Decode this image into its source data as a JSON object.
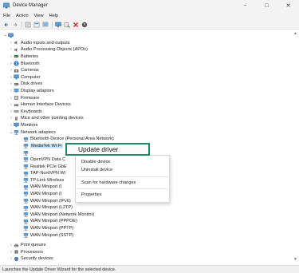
{
  "window": {
    "title": "Device Manager",
    "controls": {
      "minimize": "−",
      "maximize": "□",
      "close": "✕"
    }
  },
  "menubar": [
    "File",
    "Action",
    "View",
    "Help"
  ],
  "toolbar": [
    "back-icon",
    "forward-icon",
    "properties-icon",
    "help-icon",
    "scan-icon",
    "monitor-icon",
    "update-driver-icon",
    "remove-device-icon",
    "disable-device-icon"
  ],
  "colors": {
    "accent_green": "#1a8d64",
    "selection": "#cce4f7"
  },
  "tree": {
    "root_icon": "computer-icon",
    "categories_top": [
      {
        "label": "Audio inputs and outputs",
        "icon": "audio-icon"
      },
      {
        "label": "Audio Processing Objects (APOs)",
        "icon": "audio-icon"
      },
      {
        "label": "Batteries",
        "icon": "battery-icon"
      },
      {
        "label": "Bluetooth",
        "icon": "bluetooth-icon"
      },
      {
        "label": "Cameras",
        "icon": "camera-icon"
      },
      {
        "label": "Computer",
        "icon": "computer-icon"
      },
      {
        "label": "Disk drives",
        "icon": "disk-icon"
      },
      {
        "label": "Display adaptors",
        "icon": "display-icon"
      },
      {
        "label": "Firmware",
        "icon": "firmware-icon"
      },
      {
        "label": "Human Interface Devices",
        "icon": "hid-icon"
      },
      {
        "label": "Keyboards",
        "icon": "keyboard-icon"
      },
      {
        "label": "Mice and other pointing devices",
        "icon": "mouse-icon"
      },
      {
        "label": "Monitors",
        "icon": "monitor-icon"
      },
      {
        "label": "Network adapters",
        "icon": "network-icon"
      }
    ],
    "network_children": [
      "Bluetooth Device (Personal Area Network)",
      "MediaTek Wi-Fi",
      "",
      "OpenVPN Data C",
      "Realtek PCIe GbE",
      "TAP-NordVPN Wi",
      "TP-Link Wireless",
      "WAN Miniport (I",
      "WAN Miniport (I",
      "WAN Miniport (IPv6)",
      "WAN Miniport (L2TP)",
      "WAN Miniport (Network Monitor)",
      "WAN Miniport (PPPOE)",
      "WAN Miniport (PPTP)",
      "WAN Miniport (SSTP)"
    ],
    "categories_bottom": [
      {
        "label": "Print queues",
        "icon": "printer-icon"
      },
      {
        "label": "Processors",
        "icon": "processor-icon"
      },
      {
        "label": "Security devices",
        "icon": "security-icon"
      }
    ]
  },
  "context_menu": {
    "highlighted": "Update driver",
    "items": [
      "Disable device",
      "Uninstall device",
      "Scan for hardware changes",
      "Properties"
    ]
  },
  "statusbar": "Launches the Update Driver Wizard for the selected device."
}
